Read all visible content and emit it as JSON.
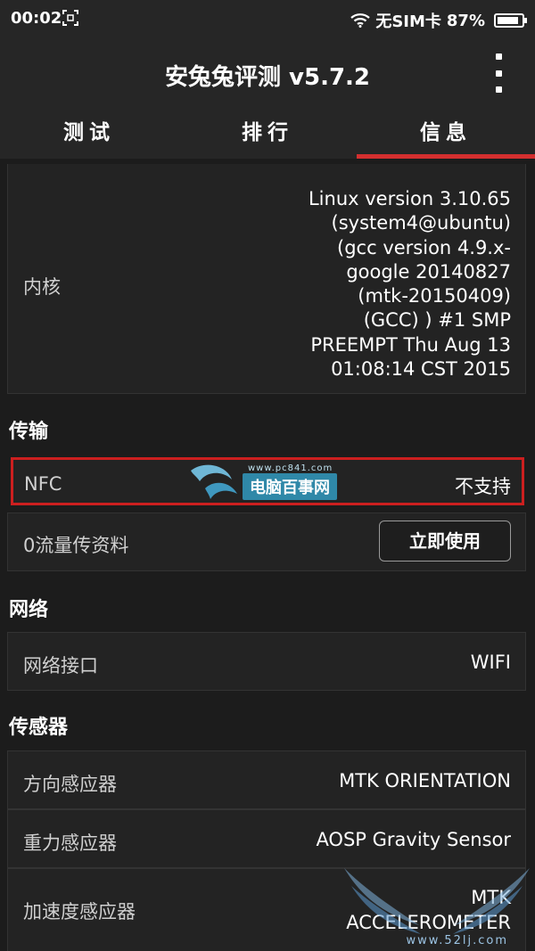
{
  "status_bar": {
    "time": "00:02",
    "sim": "无SIM卡",
    "battery": "87%",
    "battery_level": 0.87
  },
  "app_bar": {
    "title": "安兔兔评测 v5.7.2"
  },
  "tabs": [
    {
      "label": "测试"
    },
    {
      "label": "排行"
    },
    {
      "label": "信息",
      "active": true
    }
  ],
  "kernel": {
    "label": "内核",
    "value_lines": [
      "Linux version 3.10.65",
      "(system4@ubuntu)",
      "(gcc version 4.9.x-",
      "google 20140827",
      "(mtk-20150409)",
      "(GCC) ) #1 SMP",
      "PREEMPT Thu Aug 13",
      "01:08:14 CST 2015"
    ]
  },
  "transfer": {
    "header": "传输",
    "nfc": {
      "label": "NFC",
      "value": "不支持"
    },
    "zero_data": {
      "label": "0流量传资料",
      "button": "立即使用"
    }
  },
  "network": {
    "header": "网络",
    "interface": {
      "label": "网络接口",
      "value": "WIFI"
    }
  },
  "sensors": {
    "header": "传感器",
    "items": [
      {
        "label": "方向感应器",
        "value_lines": [
          "MTK ORIENTATION"
        ]
      },
      {
        "label": "重力感应器",
        "value_lines": [
          "AOSP Gravity Sensor"
        ]
      },
      {
        "label": "加速度感应器",
        "value_lines": [
          "MTK",
          "ACCELEROMETER"
        ]
      }
    ]
  },
  "watermarks": {
    "site1_url": "www.pc841.com",
    "site1_name": "电脑百事网",
    "site2_url": "www.52lj.com"
  },
  "colors": {
    "accent": "#d32f2f",
    "highlight_box": "#cc1f1f",
    "watermark_blue": "#2f88a8"
  }
}
